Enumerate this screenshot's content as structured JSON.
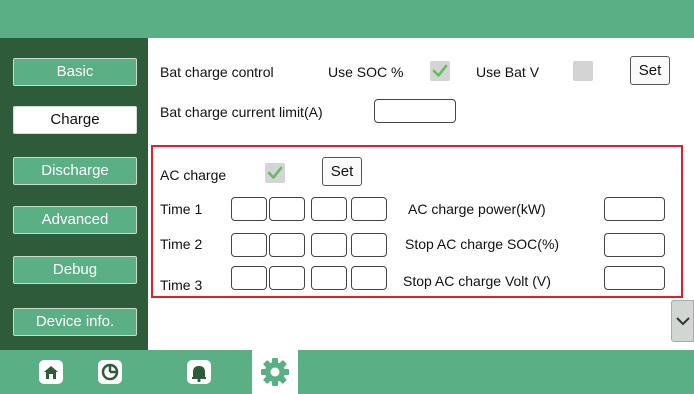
{
  "sidebar": {
    "items": [
      {
        "label": "Basic"
      },
      {
        "label": "Charge"
      },
      {
        "label": "Discharge"
      },
      {
        "label": "Advanced"
      },
      {
        "label": "Debug"
      },
      {
        "label": "Device info."
      }
    ]
  },
  "charge": {
    "bat_charge_control_label": "Bat charge control",
    "use_soc_label": "Use SOC %",
    "use_soc_checked": true,
    "use_bat_v_label": "Use Bat V",
    "use_bat_v_checked": false,
    "set_label": "Set",
    "current_limit_label": "Bat charge current limit(A)",
    "current_limit_value": ""
  },
  "ac_charge": {
    "label": "AC charge",
    "checked": true,
    "set_label": "Set",
    "times": [
      {
        "label": "Time  1",
        "values": [
          "",
          "",
          "",
          ""
        ]
      },
      {
        "label": "Time  2",
        "values": [
          "",
          "",
          "",
          ""
        ]
      },
      {
        "label": "Time  3",
        "values": [
          "",
          "",
          "",
          ""
        ]
      }
    ],
    "power_label": "AC charge power(kW)",
    "power_value": "",
    "stop_soc_label": "Stop AC charge SOC(%)",
    "stop_soc_value": "",
    "stop_volt_label": "Stop AC charge Volt (V)",
    "stop_volt_value": ""
  },
  "colors": {
    "header": "#5aaf84",
    "sidebar": "#2e5b39",
    "highlight_border": "#e0202a",
    "check": "#5fbf5f"
  },
  "bottom_nav": {
    "icons": [
      "home-icon",
      "pie-chart-icon",
      "bell-icon",
      "gear-icon"
    ]
  }
}
